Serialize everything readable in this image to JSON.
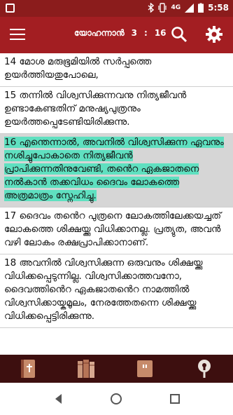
{
  "status": {
    "time": "5:58",
    "network": "4G"
  },
  "header": {
    "book": "യോഹന്നാൻ",
    "chapter": "3",
    "separator": ":",
    "verse": "16"
  },
  "verses": [
    {
      "text": "14 മോശ മരുഭൂമിയിൽ സർപ്പത്തെ ഉയർത്തിയതുപോലെ,"
    },
    {
      "text": "15 തന്നിൽ വിശ്വസിക്കുന്നവനു നിത്യജീവൻ ഉണ്ടാകേണ്ടതിന് മനുഷ്യപുത്രനും ഉയർത്തപ്പെടേണ്ടിയിരിക്കുന്നു."
    },
    {
      "text": "16 എന്തെന്നാൽ, അവനിൽ വിശ്വസിക്കുന്ന ഏവനും നശിച്ചുപോകാതെ നിത്യജീവൻ പ്രാപിക്കുന്നതിനുവേണ്ടി, തൻെറ ഏകജാതനെ നൽകാൻ തക്കവിധം ദൈവം ലോകത്തെ അത്രമാത്രം സ്നേഹിച്ചു."
    },
    {
      "text": "17 ദൈവം തൻെറ പുത്രനെ ലോകത്തിലേക്കയച്ചത് ലോകത്തെ ശിക്ഷയ്ക്കു വിധിക്കാനല്ല. പ്രത്യുത, അവൻ വഴി ലോകം രക്ഷപ്രാപിക്കാനാണ്."
    },
    {
      "text": "18 അവനിൽ വിശ്വസിക്കുന്ന ഒരുവനും ശിക്ഷയ്ക്കു വിധിക്കപ്പെടുന്നില്ല. വിശ്വസിക്കാത്തവനോ, ദൈവത്തിൻെറ ഏകജാതൻെറ നാമത്തിൽ വിശ്വസിക്കായ്കമൂലം, നേരത്തേതന്നെ ശിക്ഷയ്ക്കു വിധിക്കപ്പെട്ടിരിക്കുന്നു."
    }
  ],
  "colors": {
    "appbar": "#a31e22",
    "statusbar": "#8b1c1c",
    "tabbar": "#3d0f0f",
    "highlight": "#5fe0c0",
    "selected_bg": "#d6d6d6"
  },
  "icons": [
    "menu-icon",
    "search-icon",
    "gear-icon",
    "bible-icon",
    "books-icon",
    "quote-icon",
    "bookmark-icon",
    "back-icon",
    "home-icon",
    "recents-icon"
  ]
}
